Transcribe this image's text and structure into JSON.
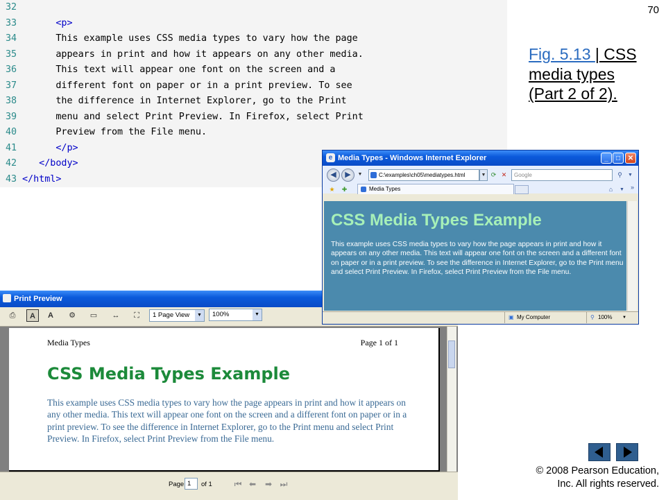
{
  "slide": {
    "page_number": "70",
    "fig_link": "Fig. 5.13 ",
    "fig_sep": "|",
    "fig_title": " CSS media types (Part 2 of 2).",
    "copyright_symbol": "©",
    "copyright_line1": " 2008 Pearson Education,",
    "copyright_line2": "Inc.  All rights reserved.",
    "nav_prev_icon": "previous-arrow-icon",
    "nav_next_icon": "next-arrow-icon",
    "nav_color": "#2f5e8f"
  },
  "code": {
    "lines": [
      {
        "num": "32",
        "text": ""
      },
      {
        "num": "33",
        "text": "      <p>"
      },
      {
        "num": "34",
        "text": "      This example uses CSS media types to vary how the page"
      },
      {
        "num": "35",
        "text": "      appears in print and how it appears on any other media."
      },
      {
        "num": "36",
        "text": "      This text will appear one font on the screen and a"
      },
      {
        "num": "37",
        "text": "      different font on paper or in a print preview. To see"
      },
      {
        "num": "38",
        "text": "      the difference in Internet Explorer, go to the Print"
      },
      {
        "num": "39",
        "text": "      menu and select Print Preview. In Firefox, select Print"
      },
      {
        "num": "40",
        "text": "      Preview from the File menu."
      },
      {
        "num": "41",
        "text": "      </p>"
      },
      {
        "num": "42",
        "text": "   </body>"
      },
      {
        "num": "43",
        "text": "</html>"
      }
    ]
  },
  "ie": {
    "title": "Media Types - Windows Internet Explorer",
    "address": "C:\\examples\\ch05\\mediatypes.html",
    "search_placeholder": "Google",
    "tab_label": "Media Types",
    "chevron": "»",
    "heading": "CSS Media Types Example",
    "body": "This example uses CSS media types to vary how the page appears in print and how it appears on any other media. This text will appear one font on the screen and a different font on paper or in a print preview. To see the difference in Internet Explorer, go to the Print menu and select Print Preview. In Firefox, select Print Preview from the File menu.",
    "status_zone": "My Computer",
    "status_zoom": "100%",
    "background_color": "#4b8aad",
    "heading_color": "#a7f0b8"
  },
  "print_preview": {
    "title": "Print Preview",
    "page_view": "1 Page View",
    "zoom": "100%",
    "header_left": "Media Types",
    "header_right": "Page 1 of 1",
    "heading": "CSS Media Types Example",
    "body": "This example uses CSS media types to vary how the page appears in print and how it appears on any other media. This text will appear one font on the screen and a different font on paper or in a print preview. To see the difference in Internet Explorer, go to the Print menu and select Print Preview. In Firefox, select Print Preview from the File menu.",
    "page_label": "Page",
    "page_value": "1",
    "page_of": "of 1",
    "heading_color": "#1c8a3a",
    "body_color": "#3a6a95"
  }
}
